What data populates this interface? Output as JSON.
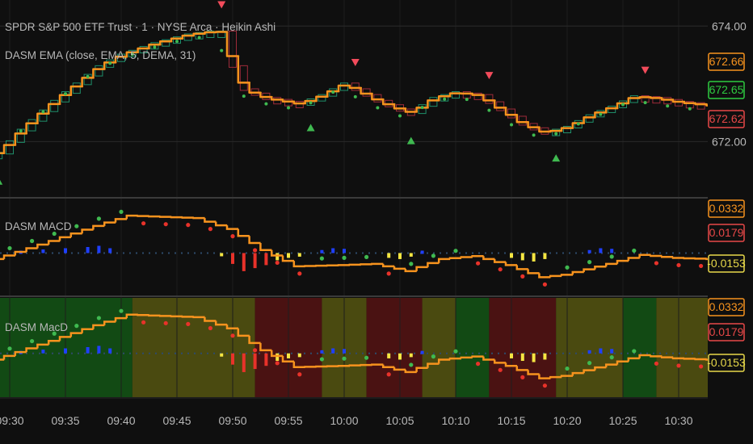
{
  "header": {
    "symbol_line": "SPDR S&P 500 ETF Trust · 1 · NYSE Arca · Heikin Ashi",
    "indicator_line": "DASM EMA (close, EMA, 5, DEMA, 31)"
  },
  "panes": {
    "macd_title": "DASM MACD",
    "macd2_title": "DASM MacD"
  },
  "price_axis": {
    "ticks": [
      "674.00",
      "672.00"
    ],
    "badges": [
      {
        "value": "672.66",
        "color": "#f7931e"
      },
      {
        "value": "672.65",
        "color": "#2ecc40"
      },
      {
        "value": "672.62",
        "color": "#e84848"
      }
    ]
  },
  "macd_axis": {
    "badges": [
      {
        "value": "0.0332",
        "color": "#f7931e"
      },
      {
        "value": "0.0179",
        "color": "#e84848"
      },
      {
        "value": "-0.0153",
        "color": "#e8d94a"
      }
    ]
  },
  "macd2_axis": {
    "badges": [
      {
        "value": "0.0332",
        "color": "#f7931e"
      },
      {
        "value": "0.0179",
        "color": "#e84848"
      },
      {
        "value": "-0.0153",
        "color": "#e8d94a"
      }
    ]
  },
  "time_axis": [
    "09:30",
    "09:35",
    "09:40",
    "09:45",
    "09:50",
    "09:55",
    "10:00",
    "10:05",
    "10:10",
    "10:15",
    "10:20",
    "10:25",
    "10:30"
  ],
  "colors": {
    "background": "#0f0f0f",
    "ema_line": "#f7931e",
    "candle_up": "#1f8f6a",
    "candle_down": "#9e2b3a",
    "buy_arrow": "#3fb950",
    "sell_arrow": "#f24b5b",
    "zone_green": "#124a14",
    "zone_olive": "#4a4a10",
    "zone_red": "#4a1212"
  },
  "chart_data": {
    "type": "line",
    "title": "SPDR S&P 500 ETF Trust · 1 · NYSE Arca · Heikin Ashi",
    "xlabel": "",
    "ylabel": "",
    "x": [
      "09:30",
      "09:35",
      "09:40",
      "09:45",
      "09:50",
      "09:55",
      "10:00",
      "10:05",
      "10:10",
      "10:15",
      "10:20",
      "10:25",
      "10:30"
    ],
    "ylim": [
      671.6,
      674.2
    ],
    "price_anchors": [
      [
        "09:29",
        671.8
      ],
      [
        "09:31",
        672.2
      ],
      [
        "09:34",
        672.7
      ],
      [
        "09:36",
        673.0
      ],
      [
        "09:38",
        673.3
      ],
      [
        "09:40",
        673.5
      ],
      [
        "09:43",
        673.7
      ],
      [
        "09:46",
        673.85
      ],
      [
        "09:48",
        673.9
      ],
      [
        "09:49",
        673.9
      ],
      [
        "09:50",
        673.3
      ],
      [
        "09:51",
        672.9
      ],
      [
        "09:53",
        672.75
      ],
      [
        "09:56",
        672.65
      ],
      [
        "09:58",
        672.8
      ],
      [
        "10:00",
        673.0
      ],
      [
        "10:01",
        672.9
      ],
      [
        "10:03",
        672.7
      ],
      [
        "10:05",
        672.55
      ],
      [
        "10:06",
        672.5
      ],
      [
        "10:08",
        672.75
      ],
      [
        "10:10",
        672.85
      ],
      [
        "10:12",
        672.8
      ],
      [
        "10:14",
        672.55
      ],
      [
        "10:16",
        672.3
      ],
      [
        "10:18",
        672.15
      ],
      [
        "10:20",
        672.25
      ],
      [
        "10:22",
        672.45
      ],
      [
        "10:24",
        672.6
      ],
      [
        "10:26",
        672.78
      ],
      [
        "10:28",
        672.75
      ],
      [
        "10:30",
        672.68
      ],
      [
        "10:33",
        672.62
      ]
    ],
    "markers": {
      "sell": [
        "09:49",
        "10:01",
        "10:13",
        "10:27"
      ],
      "buy": [
        "09:29",
        "09:57",
        "10:06",
        "10:19"
      ]
    },
    "macd": {
      "ylim": [
        -0.065,
        0.085
      ],
      "line": [
        [
          "09:29",
          -0.01
        ],
        [
          "09:34",
          0.02
        ],
        [
          "09:38",
          0.045
        ],
        [
          "09:41",
          0.062
        ],
        [
          "09:47",
          0.058
        ],
        [
          "09:50",
          0.04
        ],
        [
          "09:53",
          0.005
        ],
        [
          "09:56",
          -0.022
        ],
        [
          "10:00",
          -0.02
        ],
        [
          "10:03",
          -0.018
        ],
        [
          "10:06",
          -0.03
        ],
        [
          "10:09",
          -0.01
        ],
        [
          "10:12",
          -0.005
        ],
        [
          "10:15",
          -0.02
        ],
        [
          "10:18",
          -0.04
        ],
        [
          "10:20",
          -0.036
        ],
        [
          "10:24",
          -0.018
        ],
        [
          "10:27",
          -0.003
        ],
        [
          "10:30",
          -0.008
        ],
        [
          "10:33",
          -0.01
        ]
      ],
      "histogram": [
        [
          "09:31",
          0.004
        ],
        [
          "09:33",
          0.006
        ],
        [
          "09:35",
          0.008
        ],
        [
          "09:37",
          0.01
        ],
        [
          "09:38",
          0.012
        ],
        [
          "09:39",
          0.008
        ],
        [
          "09:49",
          -0.005
        ],
        [
          "09:50",
          -0.018
        ],
        [
          "09:51",
          -0.03
        ],
        [
          "09:52",
          -0.025
        ],
        [
          "09:53",
          -0.02
        ],
        [
          "09:54",
          -0.012
        ],
        [
          "09:55",
          -0.008
        ],
        [
          "09:56",
          -0.006
        ],
        [
          "09:58",
          0.005
        ],
        [
          "09:59",
          0.008
        ],
        [
          "10:00",
          0.007
        ],
        [
          "10:04",
          -0.008
        ],
        [
          "10:05",
          -0.01
        ],
        [
          "10:06",
          -0.006
        ],
        [
          "10:07",
          0.004
        ],
        [
          "10:15",
          -0.008
        ],
        [
          "10:16",
          -0.012
        ],
        [
          "10:17",
          -0.014
        ],
        [
          "10:18",
          -0.01
        ],
        [
          "10:22",
          0.005
        ],
        [
          "10:23",
          0.008
        ],
        [
          "10:24",
          0.007
        ]
      ],
      "zones": [
        [
          "09:29",
          "09:41",
          "green"
        ],
        [
          "09:41",
          "09:52",
          "olive"
        ],
        [
          "09:52",
          "09:58",
          "red"
        ],
        [
          "09:58",
          "10:02",
          "olive"
        ],
        [
          "10:02",
          "10:07",
          "red"
        ],
        [
          "10:07",
          "10:10",
          "olive"
        ],
        [
          "10:10",
          "10:13",
          "green"
        ],
        [
          "10:13",
          "10:19",
          "red"
        ],
        [
          "10:19",
          "10:25",
          "olive"
        ],
        [
          "10:25",
          "10:28",
          "green"
        ],
        [
          "10:28",
          "10:34",
          "olive"
        ]
      ]
    }
  }
}
